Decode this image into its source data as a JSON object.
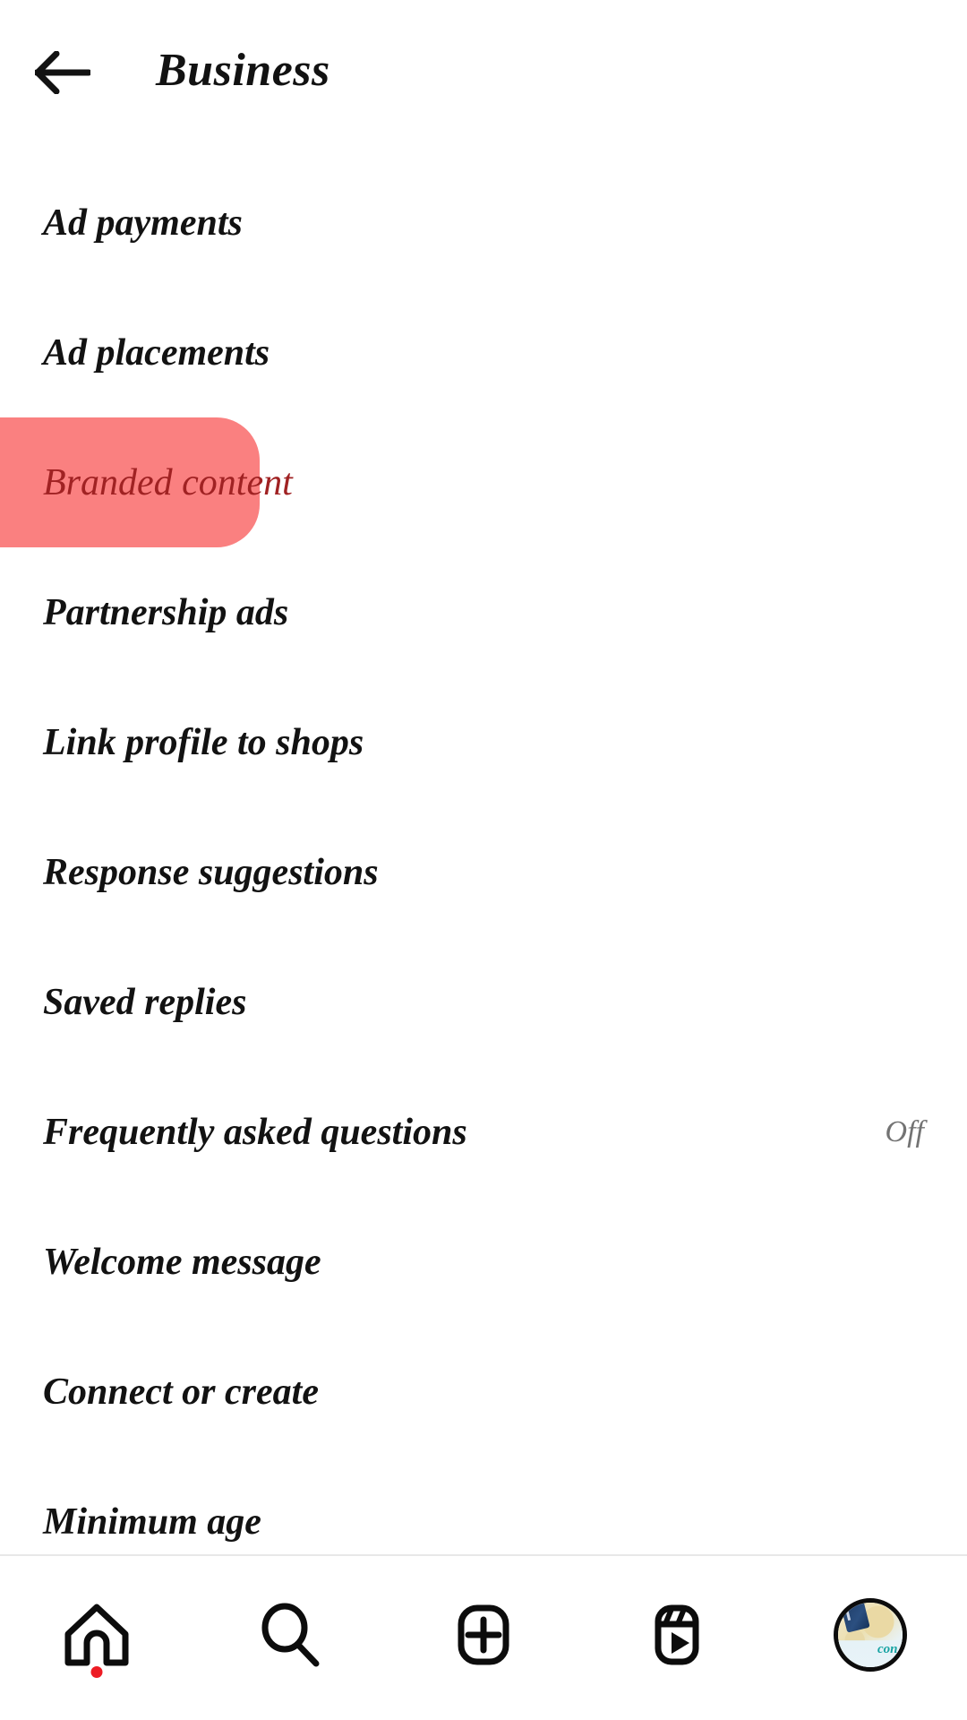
{
  "header": {
    "title": "Business",
    "back_icon": "arrow-left-icon"
  },
  "list": {
    "items": [
      {
        "label": "Ad payments",
        "value": "",
        "highlighted": false
      },
      {
        "label": "Ad placements",
        "value": "",
        "highlighted": false
      },
      {
        "label": "Branded content",
        "value": "",
        "highlighted": true
      },
      {
        "label": "Partnership ads",
        "value": "",
        "highlighted": false
      },
      {
        "label": "Link profile to shops",
        "value": "",
        "highlighted": false
      },
      {
        "label": "Response suggestions",
        "value": "",
        "highlighted": false
      },
      {
        "label": "Saved replies",
        "value": "",
        "highlighted": false
      },
      {
        "label": "Frequently asked questions",
        "value": "Off",
        "highlighted": false
      },
      {
        "label": "Welcome message",
        "value": "",
        "highlighted": false
      },
      {
        "label": "Connect or create",
        "value": "",
        "highlighted": false
      },
      {
        "label": "Minimum age",
        "value": "",
        "highlighted": false
      }
    ]
  },
  "tabbar": {
    "items": [
      {
        "name": "home",
        "icon": "home-icon",
        "badge": true
      },
      {
        "name": "search",
        "icon": "search-icon",
        "badge": false
      },
      {
        "name": "create",
        "icon": "plus-square-icon",
        "badge": false
      },
      {
        "name": "reels",
        "icon": "reels-icon",
        "badge": false
      },
      {
        "name": "profile",
        "icon": "avatar-icon",
        "badge": false
      }
    ],
    "avatar_text": "con"
  },
  "colors": {
    "highlight_background": "#FA8080",
    "highlight_text": "#A02223",
    "text_primary": "#121212",
    "text_secondary": "#737373",
    "badge": "#ED1C24",
    "background": "#FFFFFF"
  }
}
